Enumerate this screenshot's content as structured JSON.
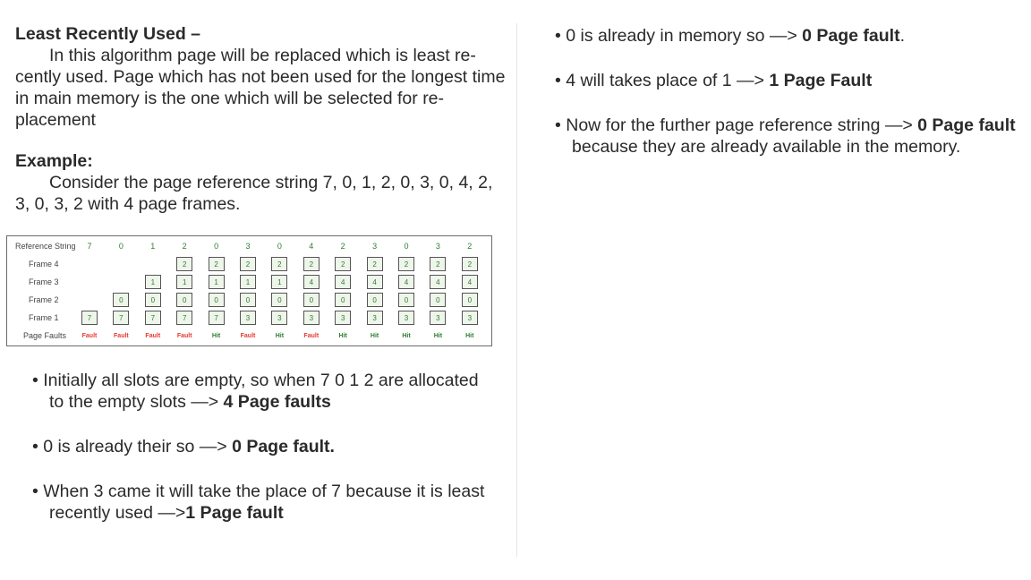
{
  "left": {
    "title": "Least Recently Used –",
    "intro": "In this algorithm page will be replaced which is least re-cently used. Page which has not been used for the longest time in main memory is the one which will be selected for re-placement",
    "example_heading": "Example:",
    "example_text": "Consider the page reference string 7, 0, 1, 2, 0, 3, 0, 4, 2, 3, 0, 3, 2 with 4 page frames."
  },
  "table": {
    "ref_label": "Reference String",
    "reference": [
      "7",
      "0",
      "1",
      "2",
      "0",
      "3",
      "0",
      "4",
      "2",
      "3",
      "0",
      "3",
      "2"
    ],
    "frames": [
      {
        "label": "Frame 4",
        "cells": [
          "",
          "",
          "",
          "2",
          "2",
          "2",
          "2",
          "2",
          "2",
          "2",
          "2",
          "2",
          "2"
        ]
      },
      {
        "label": "Frame 3",
        "cells": [
          "",
          "",
          "1",
          "1",
          "1",
          "1",
          "1",
          "4",
          "4",
          "4",
          "4",
          "4",
          "4"
        ]
      },
      {
        "label": "Frame 2",
        "cells": [
          "",
          "0",
          "0",
          "0",
          "0",
          "0",
          "0",
          "0",
          "0",
          "0",
          "0",
          "0",
          "0"
        ]
      },
      {
        "label": "Frame 1",
        "cells": [
          "7",
          "7",
          "7",
          "7",
          "7",
          "3",
          "3",
          "3",
          "3",
          "3",
          "3",
          "3",
          "3"
        ]
      }
    ],
    "faults_label": "Page Faults",
    "results": [
      "Fault",
      "Fault",
      "Fault",
      "Fault",
      "Hit",
      "Fault",
      "Hit",
      "Fault",
      "Hit",
      "Hit",
      "Hit",
      "Hit",
      "Hit"
    ],
    "colors": {
      "fault": "#e53935",
      "hit": "#2e7d32",
      "cell_bg": "#eef5ea"
    }
  },
  "bullets_left": [
    {
      "text": "Initially all slots are empty, so when 7 0 1 2 are allocated to the empty slots —> ",
      "bold": "4 Page faults",
      "after": ""
    },
    {
      "text": "0 is already their so —> ",
      "bold": "0 Page fault.",
      "after": ""
    },
    {
      "text": "When 3 came it will take the place of 7 because it is least recently used —>",
      "bold": "1 Page fault",
      "after": ""
    }
  ],
  "bullets_right": [
    {
      "text": "0 is already in memory so —> ",
      "bold": "0 Page fault",
      "after": "."
    },
    {
      "text": "4 will takes place of 1 —> ",
      "bold": "1 Page Fault",
      "after": ""
    },
    {
      "text": "Now for the further page reference string —> ",
      "bold": "0 Page fault",
      "after": " because they are already available in the memory."
    }
  ]
}
